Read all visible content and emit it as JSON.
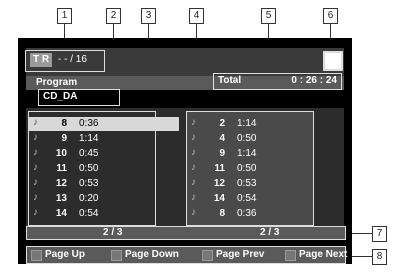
{
  "callouts": [
    "1",
    "2",
    "3",
    "4",
    "5",
    "6",
    "7",
    "8"
  ],
  "header": {
    "tr_label": "T R",
    "track_info": "- - / 16"
  },
  "program": {
    "label": "Program",
    "disc_type": "CD_DA"
  },
  "total": {
    "label": "Total",
    "time": "0 : 26 : 24"
  },
  "left_list": [
    {
      "track": "8",
      "time": "0:36",
      "selected": true
    },
    {
      "track": "9",
      "time": "1:14"
    },
    {
      "track": "10",
      "time": "0:45"
    },
    {
      "track": "11",
      "time": "0:50"
    },
    {
      "track": "12",
      "time": "0:53"
    },
    {
      "track": "13",
      "time": "0:20"
    },
    {
      "track": "14",
      "time": "0:54"
    }
  ],
  "right_list": [
    {
      "track": "2",
      "time": "1:14"
    },
    {
      "track": "4",
      "time": "0:50"
    },
    {
      "track": "9",
      "time": "1:14"
    },
    {
      "track": "11",
      "time": "0:50"
    },
    {
      "track": "12",
      "time": "0:53"
    },
    {
      "track": "14",
      "time": "0:54"
    },
    {
      "track": "8",
      "time": "0:36"
    }
  ],
  "page_left": "2 / 3",
  "page_right": "2 / 3",
  "buttons": [
    {
      "label": "Page Up"
    },
    {
      "label": "Page Down"
    },
    {
      "label": "Page Prev"
    },
    {
      "label": "Page Next"
    }
  ],
  "icons": {
    "track_icon": "note-icon",
    "stop_box": "stop-square-icon"
  }
}
